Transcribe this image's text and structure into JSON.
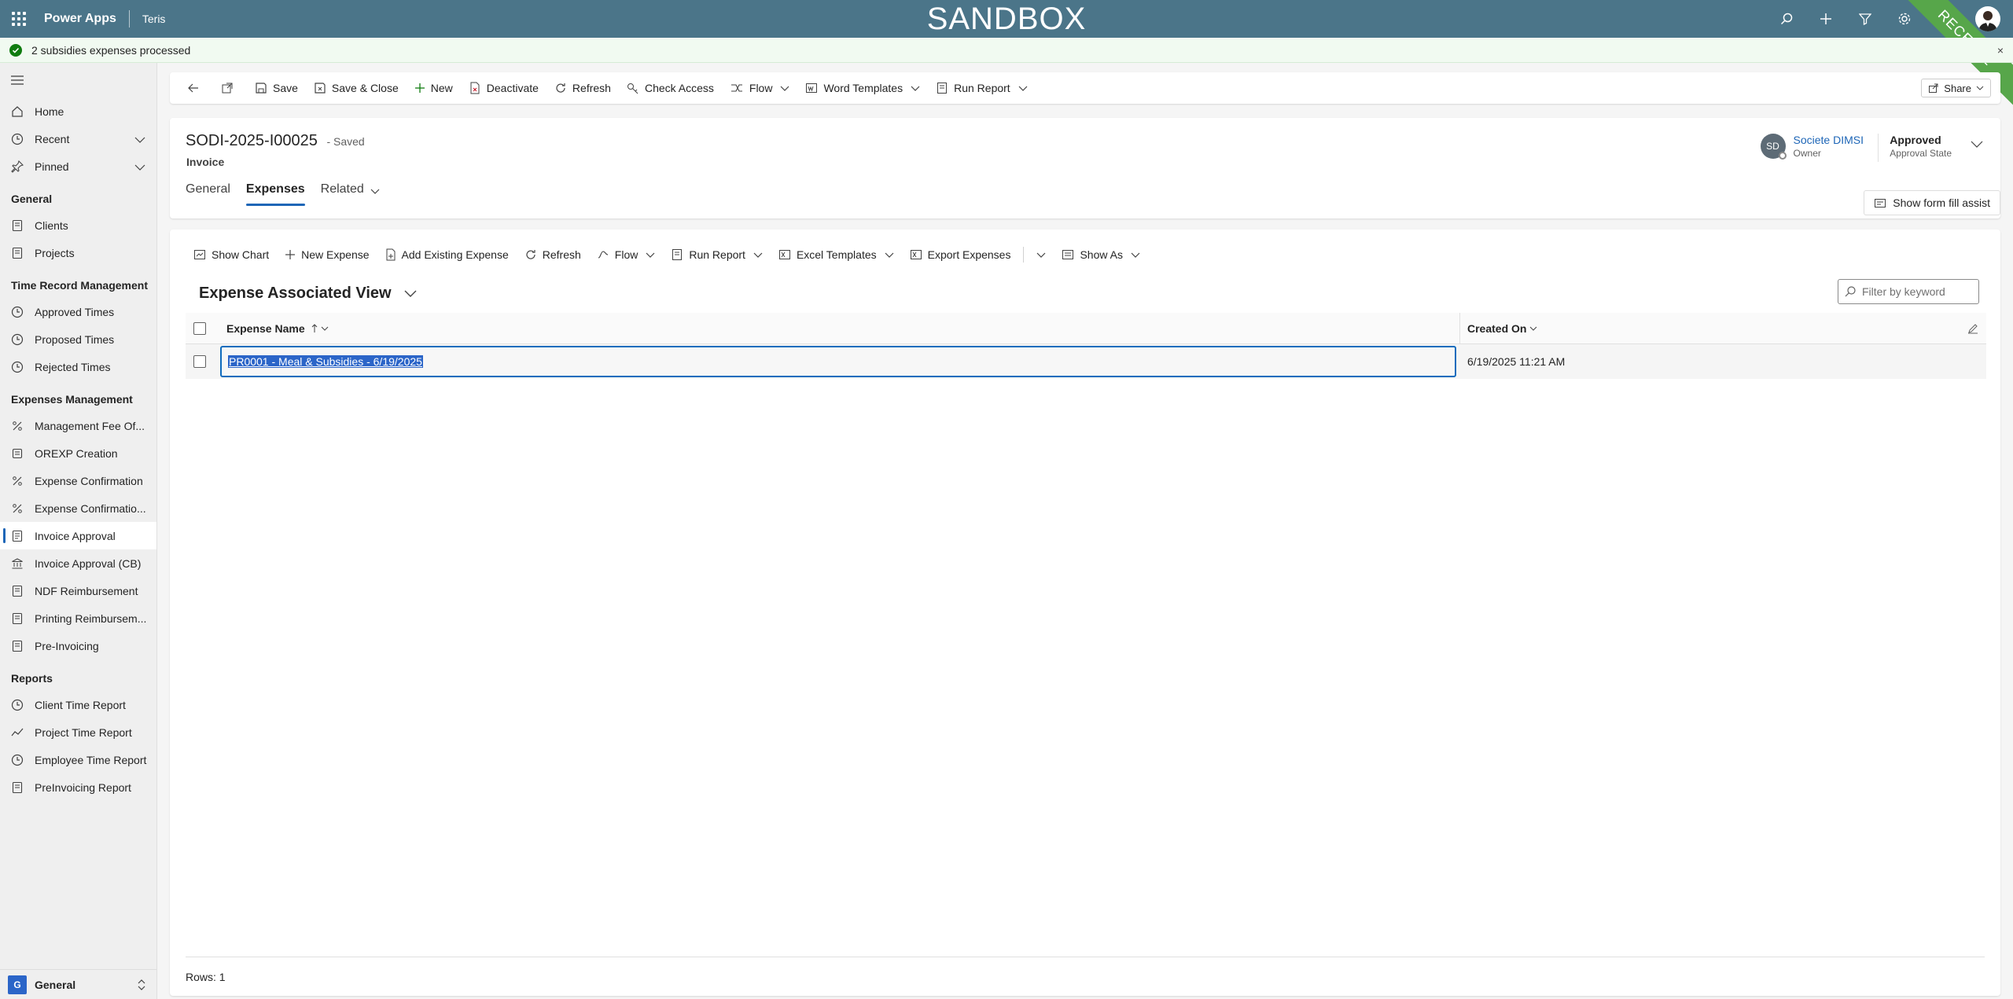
{
  "topbar": {
    "app_name": "Power Apps",
    "environment": "Teris",
    "banner": "SANDBOX",
    "ribbon": "RECETTE"
  },
  "notification": {
    "message": "2 subsidies expenses processed",
    "close": "×"
  },
  "sidebar": {
    "top_items": [
      {
        "label": "Home"
      },
      {
        "label": "Recent"
      },
      {
        "label": "Pinned"
      }
    ],
    "groups": [
      {
        "title": "General",
        "items": [
          {
            "label": "Clients"
          },
          {
            "label": "Projects"
          }
        ]
      },
      {
        "title": "Time Record Management",
        "items": [
          {
            "label": "Approved Times"
          },
          {
            "label": "Proposed Times"
          },
          {
            "label": "Rejected Times"
          }
        ]
      },
      {
        "title": "Expenses Management",
        "items": [
          {
            "label": "Management Fee Of..."
          },
          {
            "label": "OREXP Creation"
          },
          {
            "label": "Expense Confirmation"
          },
          {
            "label": "Expense Confirmatio..."
          },
          {
            "label": "Invoice Approval"
          },
          {
            "label": "Invoice Approval (CB)"
          },
          {
            "label": "NDF Reimbursement"
          },
          {
            "label": "Printing Reimbursem..."
          },
          {
            "label": "Pre-Invoicing"
          }
        ]
      },
      {
        "title": "Reports",
        "items": [
          {
            "label": "Client Time Report"
          },
          {
            "label": "Project Time Report"
          },
          {
            "label": "Employee Time Report"
          },
          {
            "label": "PreInvoicing Report"
          }
        ]
      }
    ],
    "area": {
      "badge": "G",
      "label": "General"
    }
  },
  "commandbar": {
    "save": "Save",
    "save_close": "Save & Close",
    "new": "New",
    "deactivate": "Deactivate",
    "refresh": "Refresh",
    "check_access": "Check Access",
    "flow": "Flow",
    "word_templates": "Word Templates",
    "run_report": "Run Report",
    "share": "Share"
  },
  "record": {
    "title": "SODI-2025-I00025",
    "saved_status": "- Saved",
    "entity": "Invoice",
    "tabs": [
      "General",
      "Expenses",
      "Related"
    ],
    "owner_initials": "SD",
    "owner_name": "Societe DIMSI",
    "owner_label": "Owner",
    "approval_value": "Approved",
    "approval_label": "Approval State",
    "form_fill_assist": "Show form fill assist"
  },
  "subgrid": {
    "commands": {
      "show_chart": "Show Chart",
      "new_expense": "New Expense",
      "add_existing": "Add Existing Expense",
      "refresh": "Refresh",
      "flow": "Flow",
      "run_report": "Run Report",
      "excel_templates": "Excel Templates",
      "export_expenses": "Export Expenses",
      "show_as": "Show As"
    },
    "view_name": "Expense Associated View",
    "filter_placeholder": "Filter by keyword",
    "columns": {
      "name": "Expense Name",
      "created_on": "Created On"
    },
    "rows": [
      {
        "name": "PR0001 - Meal & Subsidies - 6/19/2025",
        "created_on": "6/19/2025 11:21 AM"
      }
    ],
    "footer": "Rows: 1"
  }
}
